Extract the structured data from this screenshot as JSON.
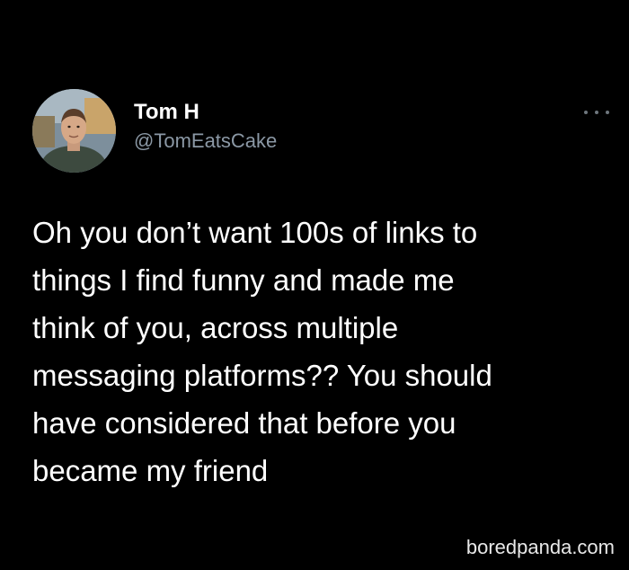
{
  "tweet": {
    "author": {
      "display_name": "Tom H",
      "handle": "@TomEatsCake",
      "avatar_icon": "profile-photo"
    },
    "more_icon": "more-horizontal-icon",
    "text": "Oh you don’t want 100s of links to\nthings I find funny and made me\nthink of you, across multiple\nmessaging platforms?? You should\nhave considered that before you\nbecame my friend"
  },
  "watermark": {
    "text": "boredpanda.com"
  },
  "colors": {
    "background": "#000000",
    "primary_text": "#ffffff",
    "secondary_text": "#8b98a5"
  }
}
